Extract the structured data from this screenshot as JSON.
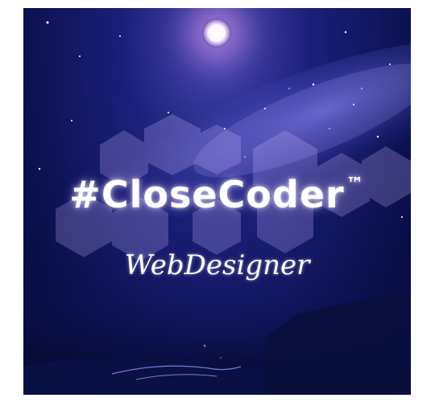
{
  "brand": {
    "title": "#CloseCoder",
    "trademark": "™",
    "subtitle": "WebDesigner"
  },
  "colors": {
    "sky_top": "#1b1f78",
    "sky_bottom": "#070a35",
    "moon_glow": "#f0aaff",
    "text": "#ffffff"
  }
}
